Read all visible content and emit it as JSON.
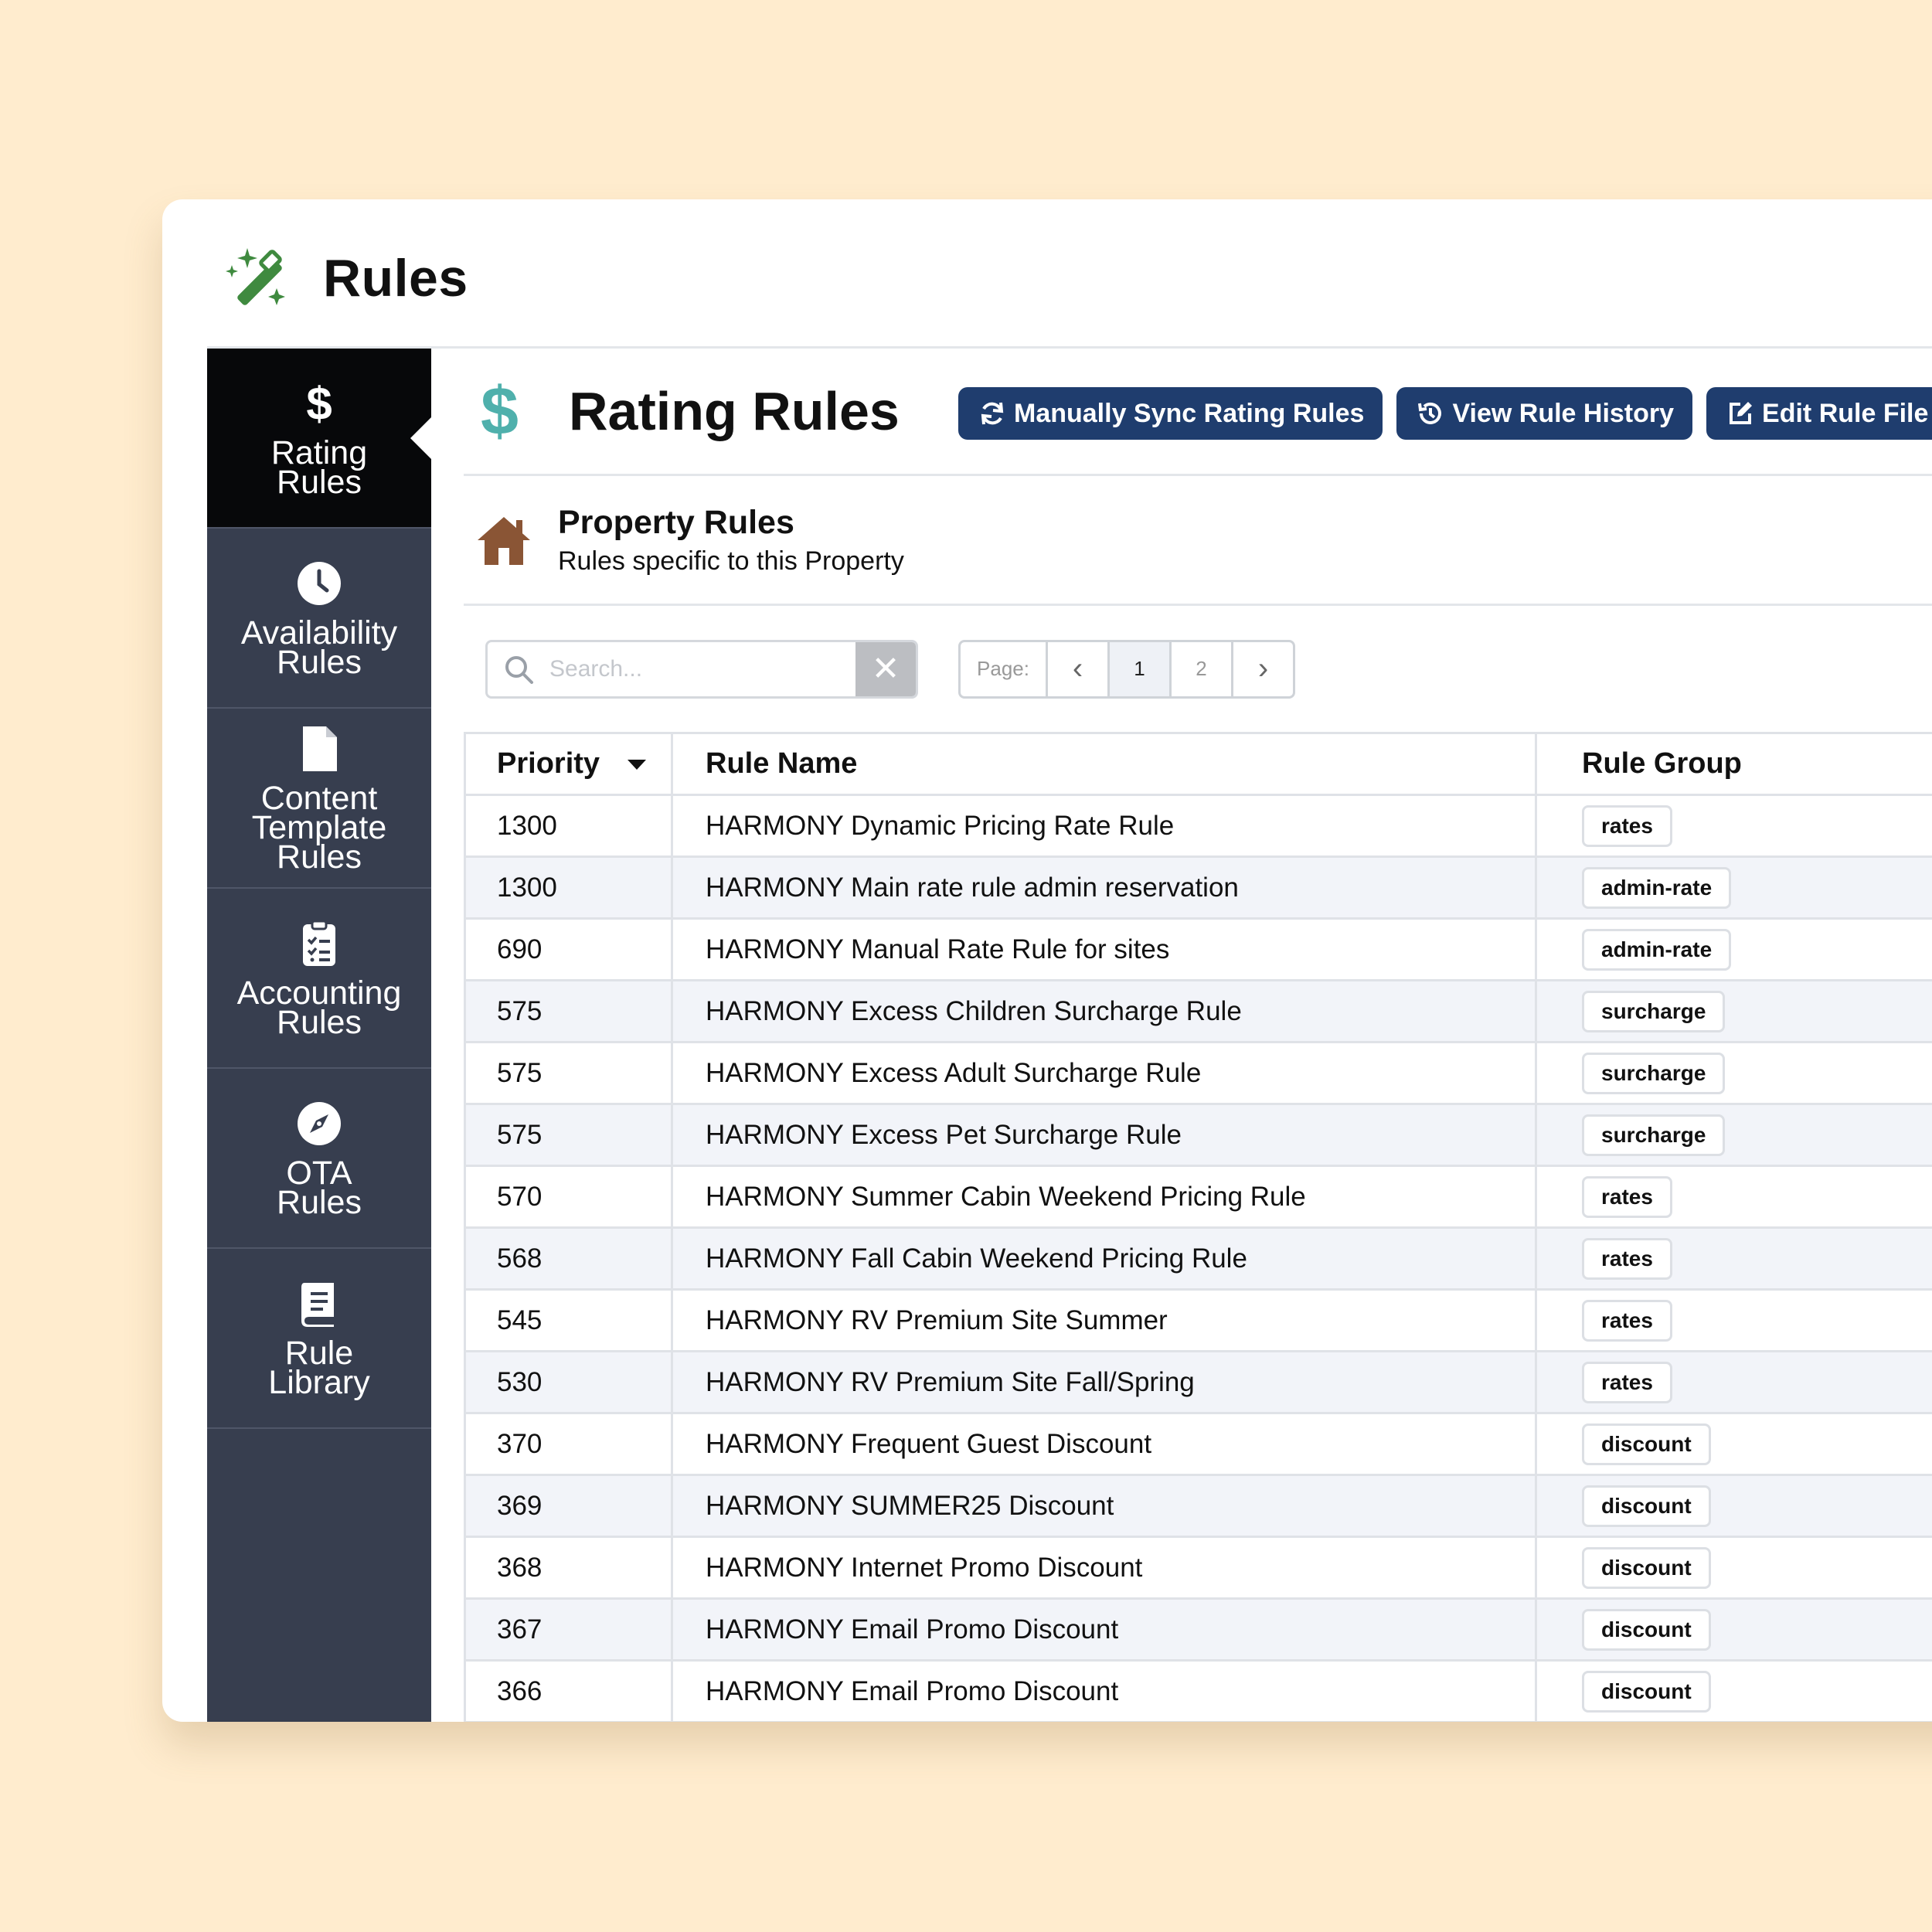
{
  "app": {
    "title": "Rules"
  },
  "sidebar": {
    "items": [
      {
        "label": "Rating\nRules",
        "icon": "dollar-icon",
        "active": true
      },
      {
        "label": "Availability\nRules",
        "icon": "clock-icon",
        "active": false
      },
      {
        "label": "Content\nTemplate\nRules",
        "icon": "file-icon",
        "active": false
      },
      {
        "label": "Accounting\nRules",
        "icon": "clipboard-icon",
        "active": false
      },
      {
        "label": "OTA\nRules",
        "icon": "compass-icon",
        "active": false
      },
      {
        "label": "Rule\nLibrary",
        "icon": "book-icon",
        "active": false
      }
    ]
  },
  "page": {
    "icon_glyph": "$",
    "title": "Rating Rules",
    "buttons": {
      "sync": "Manually Sync Rating Rules",
      "history": "View Rule History",
      "edit": "Edit Rule File"
    }
  },
  "section": {
    "title": "Property Rules",
    "subtitle": "Rules specific to this Property"
  },
  "search": {
    "placeholder": "Search...",
    "clear_glyph": "✕"
  },
  "pager": {
    "label": "Page:",
    "prev": "‹",
    "next": "›",
    "pages": [
      "1",
      "2"
    ],
    "current": "1"
  },
  "table": {
    "headers": {
      "priority": "Priority",
      "name": "Rule Name",
      "group": "Rule Group"
    },
    "rows": [
      {
        "priority": "1300",
        "name": "HARMONY Dynamic Pricing Rate Rule",
        "group": "rates"
      },
      {
        "priority": "1300",
        "name": "HARMONY Main rate rule admin reservation",
        "group": "admin-rate"
      },
      {
        "priority": "690",
        "name": "HARMONY Manual Rate Rule for sites",
        "group": "admin-rate"
      },
      {
        "priority": "575",
        "name": "HARMONY Excess Children Surcharge Rule",
        "group": "surcharge"
      },
      {
        "priority": "575",
        "name": "HARMONY Excess Adult Surcharge Rule",
        "group": "surcharge"
      },
      {
        "priority": "575",
        "name": "HARMONY Excess Pet Surcharge Rule",
        "group": "surcharge"
      },
      {
        "priority": "570",
        "name": "HARMONY Summer Cabin Weekend Pricing Rule",
        "group": "rates"
      },
      {
        "priority": "568",
        "name": "HARMONY Fall Cabin Weekend Pricing Rule",
        "group": "rates"
      },
      {
        "priority": "545",
        "name": "HARMONY RV Premium Site Summer",
        "group": "rates"
      },
      {
        "priority": "530",
        "name": "HARMONY RV Premium Site Fall/Spring",
        "group": "rates"
      },
      {
        "priority": "370",
        "name": "HARMONY Frequent Guest Discount",
        "group": "discount"
      },
      {
        "priority": "369",
        "name": "HARMONY SUMMER25 Discount",
        "group": "discount"
      },
      {
        "priority": "368",
        "name": "HARMONY Internet Promo Discount",
        "group": "discount"
      },
      {
        "priority": "367",
        "name": "HARMONY Email Promo Discount",
        "group": "discount"
      },
      {
        "priority": "366",
        "name": "HARMONY Email Promo Discount",
        "group": "discount"
      }
    ]
  },
  "colors": {
    "background": "#ffecce",
    "sidebar": "#373e4f",
    "sidebar_active": "#07080a",
    "button": "#1f3d6e",
    "dollar_accent": "#4fb0ac",
    "wand_green": "#3f8a3f",
    "house_brown": "#8a5535"
  }
}
